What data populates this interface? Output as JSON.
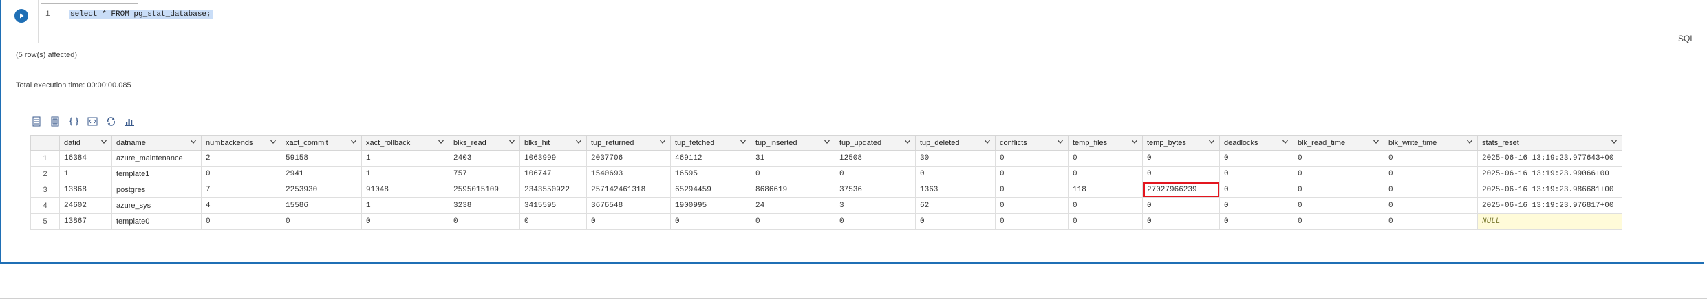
{
  "editor": {
    "line_number": "1",
    "code": "select * FROM pg_stat_database;",
    "language": "SQL"
  },
  "messages": {
    "rows_affected": "(5 row(s) affected)",
    "execution_time": "Total execution time: 00:00:00.085"
  },
  "toolbar": {
    "icons": [
      "save-as-csv-icon",
      "save-as-excel-icon",
      "save-as-json-icon",
      "save-as-xml-icon",
      "copy-icon",
      "chart-icon"
    ]
  },
  "grid": {
    "columns": [
      "datid",
      "datname",
      "numbackends",
      "xact_commit",
      "xact_rollback",
      "blks_read",
      "blks_hit",
      "tup_returned",
      "tup_fetched",
      "tup_inserted",
      "tup_updated",
      "tup_deleted",
      "conflicts",
      "temp_files",
      "temp_bytes",
      "deadlocks",
      "blk_read_time",
      "blk_write_time",
      "stats_reset"
    ],
    "rows": [
      [
        "1",
        "16384",
        "azure_maintenance",
        "2",
        "59158",
        "1",
        "2403",
        "1063999",
        "2037706",
        "469112",
        "31",
        "12508",
        "30",
        "0",
        "0",
        "0",
        "0",
        "0",
        "0",
        "2025-06-16 13:19:23.977643+00"
      ],
      [
        "2",
        "1",
        "template1",
        "0",
        "2941",
        "1",
        "757",
        "106747",
        "1540693",
        "16595",
        "0",
        "0",
        "0",
        "0",
        "0",
        "0",
        "0",
        "0",
        "0",
        "2025-06-16 13:19:23.99066+00"
      ],
      [
        "3",
        "13868",
        "postgres",
        "7",
        "2253930",
        "91048",
        "2595015109",
        "2343550922",
        "257142461318",
        "65294459",
        "8686619",
        "37536",
        "1363",
        "0",
        "118",
        "27027966239",
        "0",
        "0",
        "0",
        "2025-06-16 13:19:23.986681+00"
      ],
      [
        "4",
        "24602",
        "azure_sys",
        "4",
        "15586",
        "1",
        "3238",
        "3415595",
        "3676548",
        "1900995",
        "24",
        "3",
        "62",
        "0",
        "0",
        "0",
        "0",
        "0",
        "0",
        "2025-06-16 13:19:23.976817+00"
      ],
      [
        "5",
        "13867",
        "template0",
        "0",
        "0",
        "0",
        "0",
        "0",
        "0",
        "0",
        "0",
        "0",
        "0",
        "0",
        "0",
        "0",
        "0",
        "0",
        "0",
        "NULL"
      ]
    ],
    "highlight_color": "#e3161f"
  }
}
